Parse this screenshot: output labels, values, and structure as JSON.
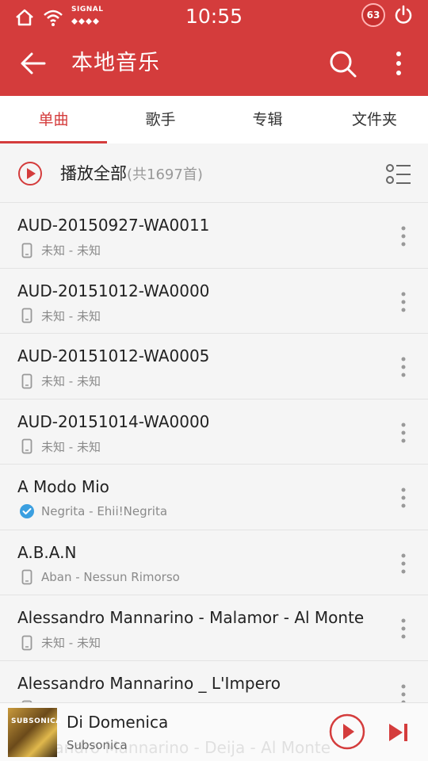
{
  "status_bar": {
    "signal_text": "SIGNAL",
    "time": "10:55",
    "badge_count": "63",
    "icons": [
      "home-icon",
      "wifi-icon",
      "signal-dots-icon",
      "heart-badge-icon",
      "power-icon"
    ]
  },
  "header": {
    "title": "本地音乐",
    "color": "#d43c3c"
  },
  "tabs": [
    {
      "label": "单曲",
      "active": true
    },
    {
      "label": "歌手",
      "active": false
    },
    {
      "label": "专辑",
      "active": false
    },
    {
      "label": "文件夹",
      "active": false
    }
  ],
  "play_all": {
    "label": "播放全部",
    "count": "(共1697首)"
  },
  "songs": [
    {
      "title": "AUD-20150927-WA0011",
      "subtitle": "未知 - 未知",
      "icon": "phone-icon"
    },
    {
      "title": "AUD-20151012-WA0000",
      "subtitle": "未知 - 未知",
      "icon": "phone-icon"
    },
    {
      "title": "AUD-20151012-WA0005",
      "subtitle": "未知 - 未知",
      "icon": "phone-icon"
    },
    {
      "title": "AUD-20151014-WA0000",
      "subtitle": "未知 - 未知",
      "icon": "phone-icon"
    },
    {
      "title": "A Modo Mio",
      "subtitle": "Negrita - Ehii!Negrita",
      "icon": "check-circle-icon"
    },
    {
      "title": "A.B.A.N",
      "subtitle": "Aban - Nessun Rimorso",
      "icon": "phone-icon"
    },
    {
      "title": "Alessandro Mannarino - Malamor - Al Monte",
      "subtitle": "未知 - 未知",
      "icon": "phone-icon"
    },
    {
      "title": "Alessandro Mannarino _ L'Impero",
      "subtitle": "",
      "icon": "phone-icon"
    }
  ],
  "mini_player": {
    "album_text": "SUBSONICA",
    "title": "Di Domenica",
    "artist": "Subsonica",
    "ghost_text": "Alessandro Mannarino - Deija - Al Monte"
  }
}
